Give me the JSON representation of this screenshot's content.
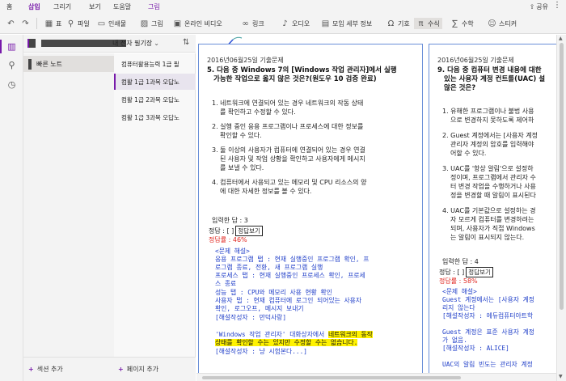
{
  "menu_tabs": [
    "홈",
    "삽입",
    "그리기",
    "보기",
    "도움말",
    "그림"
  ],
  "active_tab": "삽입",
  "share_label": "공유",
  "more_label": "⋮",
  "ribbon": {
    "table": "표",
    "file": "파일",
    "printout": "인쇄물",
    "picture": "그림",
    "online_video": "온라인 비디오",
    "link": "링크",
    "audio": "오디오",
    "meeting_details": "모임 세부 정보",
    "symbol": "기호",
    "equation": "수식",
    "math": "수학",
    "sticker": "스티커"
  },
  "notebook": {
    "name": "내 전자 필기장",
    "sections": [
      "빠른 노트"
    ],
    "add_section": "섹션 추가",
    "add_page": "페이지 추가"
  },
  "pages": [
    "컴퓨터활용능력 1급 필",
    "컴활 1급 1과목 오답노",
    "컴활 1급 2과목 오답노",
    "컴활 1급 3과목 오답노"
  ],
  "selected_page_index": 1,
  "note1": {
    "date": "2016년06월25일 기출문제",
    "question_line1": "5. 다음 중 Windows 7의 [Windows 작업 관리자]에서 실행",
    "question_line2": "가능한 작업으로 옳지 않은 것은?(원도우 10 검증 완료)",
    "options": [
      [
        "1. 네트워크에 연결되어 있는 경우 네트워크의 작동 상태",
        "를 확인하고 수정할 수 있다."
      ],
      [
        "2. 실행 중인 응용 프로그램이나 프로세스에 대한 정보를",
        "확인할 수 있다."
      ],
      [
        "3. 둘 이상의 사용자가 컴퓨터에 연결되어 있는 경우 연결",
        "된 사용자 및 작업 상황을 확인하고 사용자에게 메시지",
        "를 보낼 수 있다."
      ],
      [
        "4. 컴퓨터에서 사용되고 있는 메모리 및 CPU 리소스의 양",
        "에 대한 자세한 정보를 볼 수 있다."
      ]
    ],
    "input_answer": "입력한 답 : 3",
    "correct_answer": "정답 : [ ]",
    "show_answer_btn": "정답보기",
    "correct_rate": "정답률 : 46%",
    "explanation": [
      "<문제 해설>",
      "응용 프로그램 탭 : 현재 실행중인 프로그램 확인, 프",
      "로그램 종료, 전환, 새 프로그램 실행",
      "프로세스 탭 : 현재 실행중인 프로세스 확인, 프로세",
      "스 종료",
      "성능 탭 : CPU와 메모리 사용 현황 확인",
      "사용자 탭 : 현재 컴퓨터에 로그인 되어있는 사용자",
      "확인, 로그오프, 메시지 보내기",
      "[해설작성자 : 만덕사랑]"
    ],
    "explanation2_pre": "'Windows 작업 관리자' 대화상자에서 ",
    "explanation2_hl1": "네트워크의 동작",
    "explanation2_hl2": "상태를 확인할 수는 있지만 수정할 수는 없습니다.",
    "explanation2_author": "[해설작성자 : 냥 시험본다...]"
  },
  "note2": {
    "date": "2016년06월25일 기출문제",
    "question_line1": "9. 다음 중 컴퓨터 변경 내용에 대한",
    "question_line2": "있는 사용자 계정 컨트롤(UAC) 설",
    "question_line3": "않은 것은?",
    "options": [
      [
        "1. 유해한 프로그램이나 불법 사용",
        "으로 변경하지 못하도록 제어하"
      ],
      [
        "2. Guest 계정에서는 [사용자 계정",
        "관리자 계정의 암호를 입력해야",
        "어할 수 있다."
      ],
      [
        "3. UAC를 '항상 알림'으로 설정하",
        "정이며, 프로그램에서 관리자 수",
        "터 변경 작업을 수행하거나 사용",
        "정을 변경할 때 알림이 표시된다"
      ],
      [
        "4. UAC를 기본값으로 설정하는 경",
        "자 모르게 컴퓨터를 변경하려는",
        "되며, 사용자가 직접 Windows",
        "는 알림이 표시되지 않는다."
      ]
    ],
    "input_answer": "입력한 답 : 4",
    "correct_answer": "정답 : [ ]",
    "show_answer_btn": "정답보기",
    "correct_rate": "정답률 : 58%",
    "explanation": [
      "<문제 해설>",
      "Guest 계정에서는 [사용자 계정",
      "리지 않는다",
      "[해설작성자 : 에듀컴퓨터아트학",
      "",
      "Guest 계정은 표준 사용자 계정",
      "가 없음.",
      "[해설작성자 : ALICE]",
      "",
      "UAC의 알림 빈도는 관리자 계정"
    ]
  }
}
